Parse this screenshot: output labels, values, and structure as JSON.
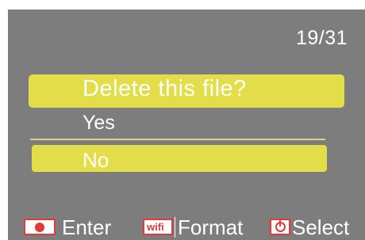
{
  "status": {
    "file_counter": "19/31"
  },
  "dialog": {
    "title": "Delete this file?",
    "options": [
      "Yes",
      "No"
    ],
    "selected_option": "No"
  },
  "footer": {
    "enter_label": "Enter",
    "format_label": "Format",
    "select_label": "Select",
    "wifi_key_text": "wifi",
    "enter_icon": "record-dot-icon",
    "format_icon": "wifi-key-icon",
    "select_icon": "power-icon"
  },
  "colors": {
    "background": "#7d7d7d",
    "highlight": "#e2dd48",
    "key_red": "#e23a3a",
    "text": "#ffffff"
  }
}
